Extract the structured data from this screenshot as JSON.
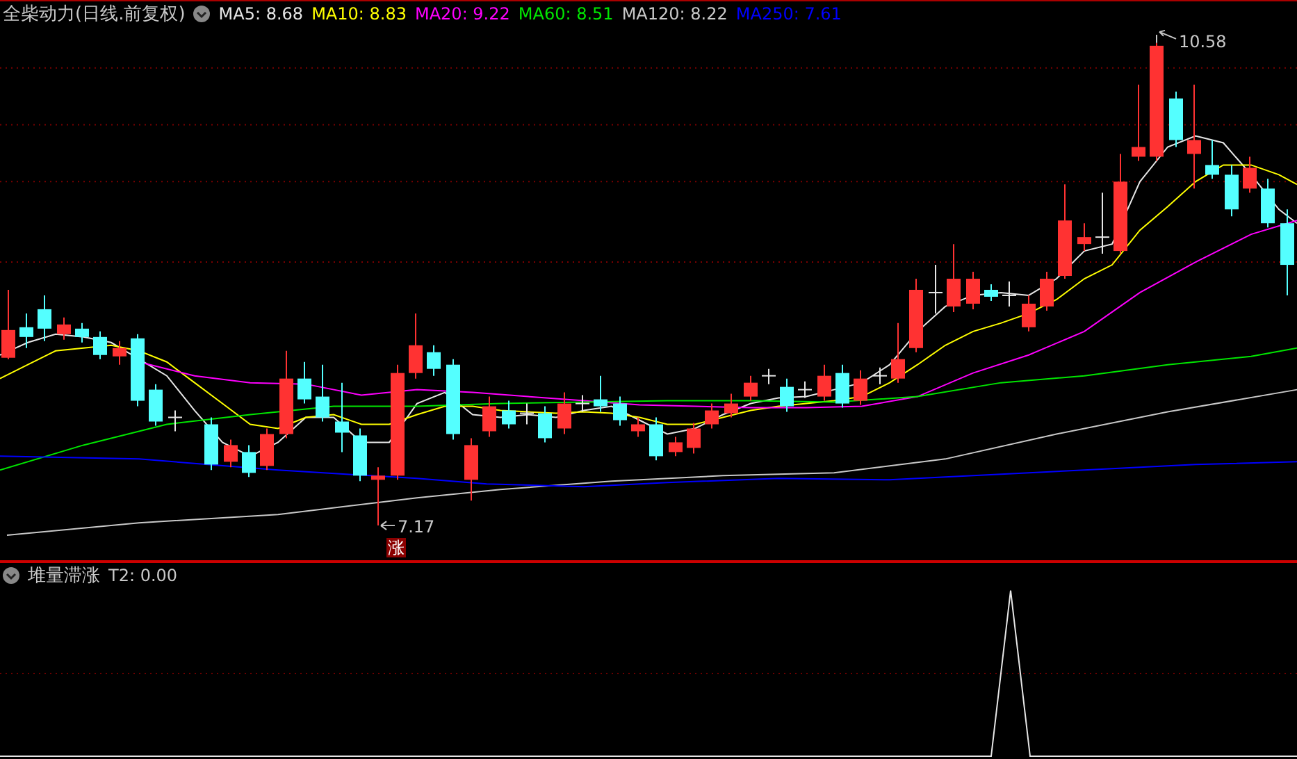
{
  "main_chart": {
    "title": "全柴动力(日线.前复权)",
    "legend": [
      {
        "label": "MA5: 8.68",
        "color": "#e6e6e6"
      },
      {
        "label": "MA10: 8.83",
        "color": "#ffff00"
      },
      {
        "label": "MA20: 9.22",
        "color": "#ff00ff"
      },
      {
        "label": "MA60: 8.51",
        "color": "#00e600"
      },
      {
        "label": "MA120: 8.22",
        "color": "#c8c8c8"
      },
      {
        "label": "MA250: 7.61",
        "color": "#0000ff"
      }
    ],
    "high_label": "10.58",
    "low_label": "7.17",
    "signal_marker": "涨"
  },
  "indicator": {
    "title": "堆量滞涨",
    "reading": "T2: 0.00"
  }
}
